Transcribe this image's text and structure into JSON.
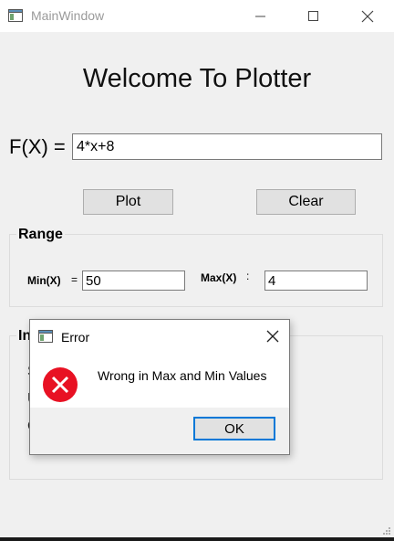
{
  "window": {
    "title": "MainWindow"
  },
  "main": {
    "heading": "Welcome To Plotter",
    "fx_label": "F(X) =",
    "fx_value": "4*x+8",
    "plot_label": "Plot",
    "clear_label": "Clear"
  },
  "range": {
    "title": "Range",
    "min_label": "Min(X)",
    "min_eq": "=",
    "min_value": "50",
    "max_label": "Max(X)",
    "max_eq": ":",
    "max_value": "4"
  },
  "info": {
    "title_partial": "In",
    "line1": "S",
    "line2": "U",
    "line3": "C"
  },
  "dialog": {
    "title": "Error",
    "message": "Wrong in Max and Min Values",
    "ok_label": "OK"
  },
  "colors": {
    "accent": "#0078d7",
    "error": "#e81123"
  }
}
